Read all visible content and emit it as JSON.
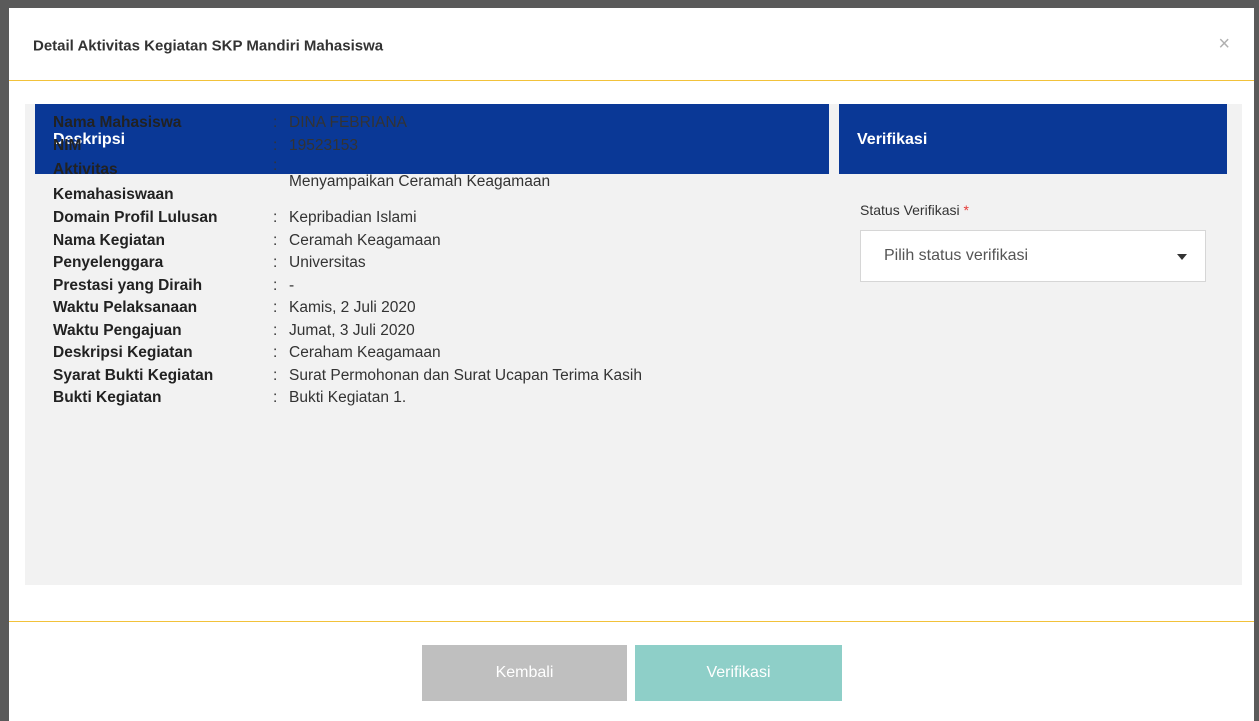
{
  "modal": {
    "title": "Detail Aktivitas Kegiatan SKP Mandiri Mahasiswa",
    "close_symbol": "×"
  },
  "left_panel": {
    "title": "Deskripsi"
  },
  "right_panel": {
    "title": "Verifikasi"
  },
  "details": [
    {
      "label": "Nama Mahasiswa",
      "value": "DINA FEBRIANA"
    },
    {
      "label": "NIM",
      "value": "19523153"
    },
    {
      "label": "Aktivitas Kemahasiswaan",
      "value": "Menyampaikan Ceramah Keagamaan"
    },
    {
      "label": "Domain Profil Lulusan",
      "value": "Kepribadian Islami"
    },
    {
      "label": "Nama Kegiatan",
      "value": "Ceramah Keagamaan"
    },
    {
      "label": "Penyelenggara",
      "value": "Universitas"
    },
    {
      "label": "Prestasi yang Diraih",
      "value": "-"
    },
    {
      "label": "Waktu Pelaksanaan",
      "value": "Kamis, 2 Juli 2020"
    },
    {
      "label": "Waktu Pengajuan",
      "value": "Jumat, 3 Juli 2020"
    },
    {
      "label": "Deskripsi Kegiatan",
      "value": "Ceraham Keagamaan"
    },
    {
      "label": "Syarat Bukti Kegiatan",
      "value": "Surat Permohonan dan Surat Ucapan Terima Kasih"
    },
    {
      "label": "Bukti Kegiatan",
      "value": "Bukti Kegiatan 1."
    }
  ],
  "separator": ":",
  "verification": {
    "label": "Status Verifikasi",
    "required_mark": "*",
    "placeholder": "Pilih status verifikasi"
  },
  "buttons": {
    "back_label": "Kembali",
    "verify_label": "Verifikasi"
  },
  "colors": {
    "header_blue": "#0a3896",
    "accent_line": "#f2c23a",
    "verify_button": "#8ecfc8",
    "back_button": "#bfbfbf"
  }
}
